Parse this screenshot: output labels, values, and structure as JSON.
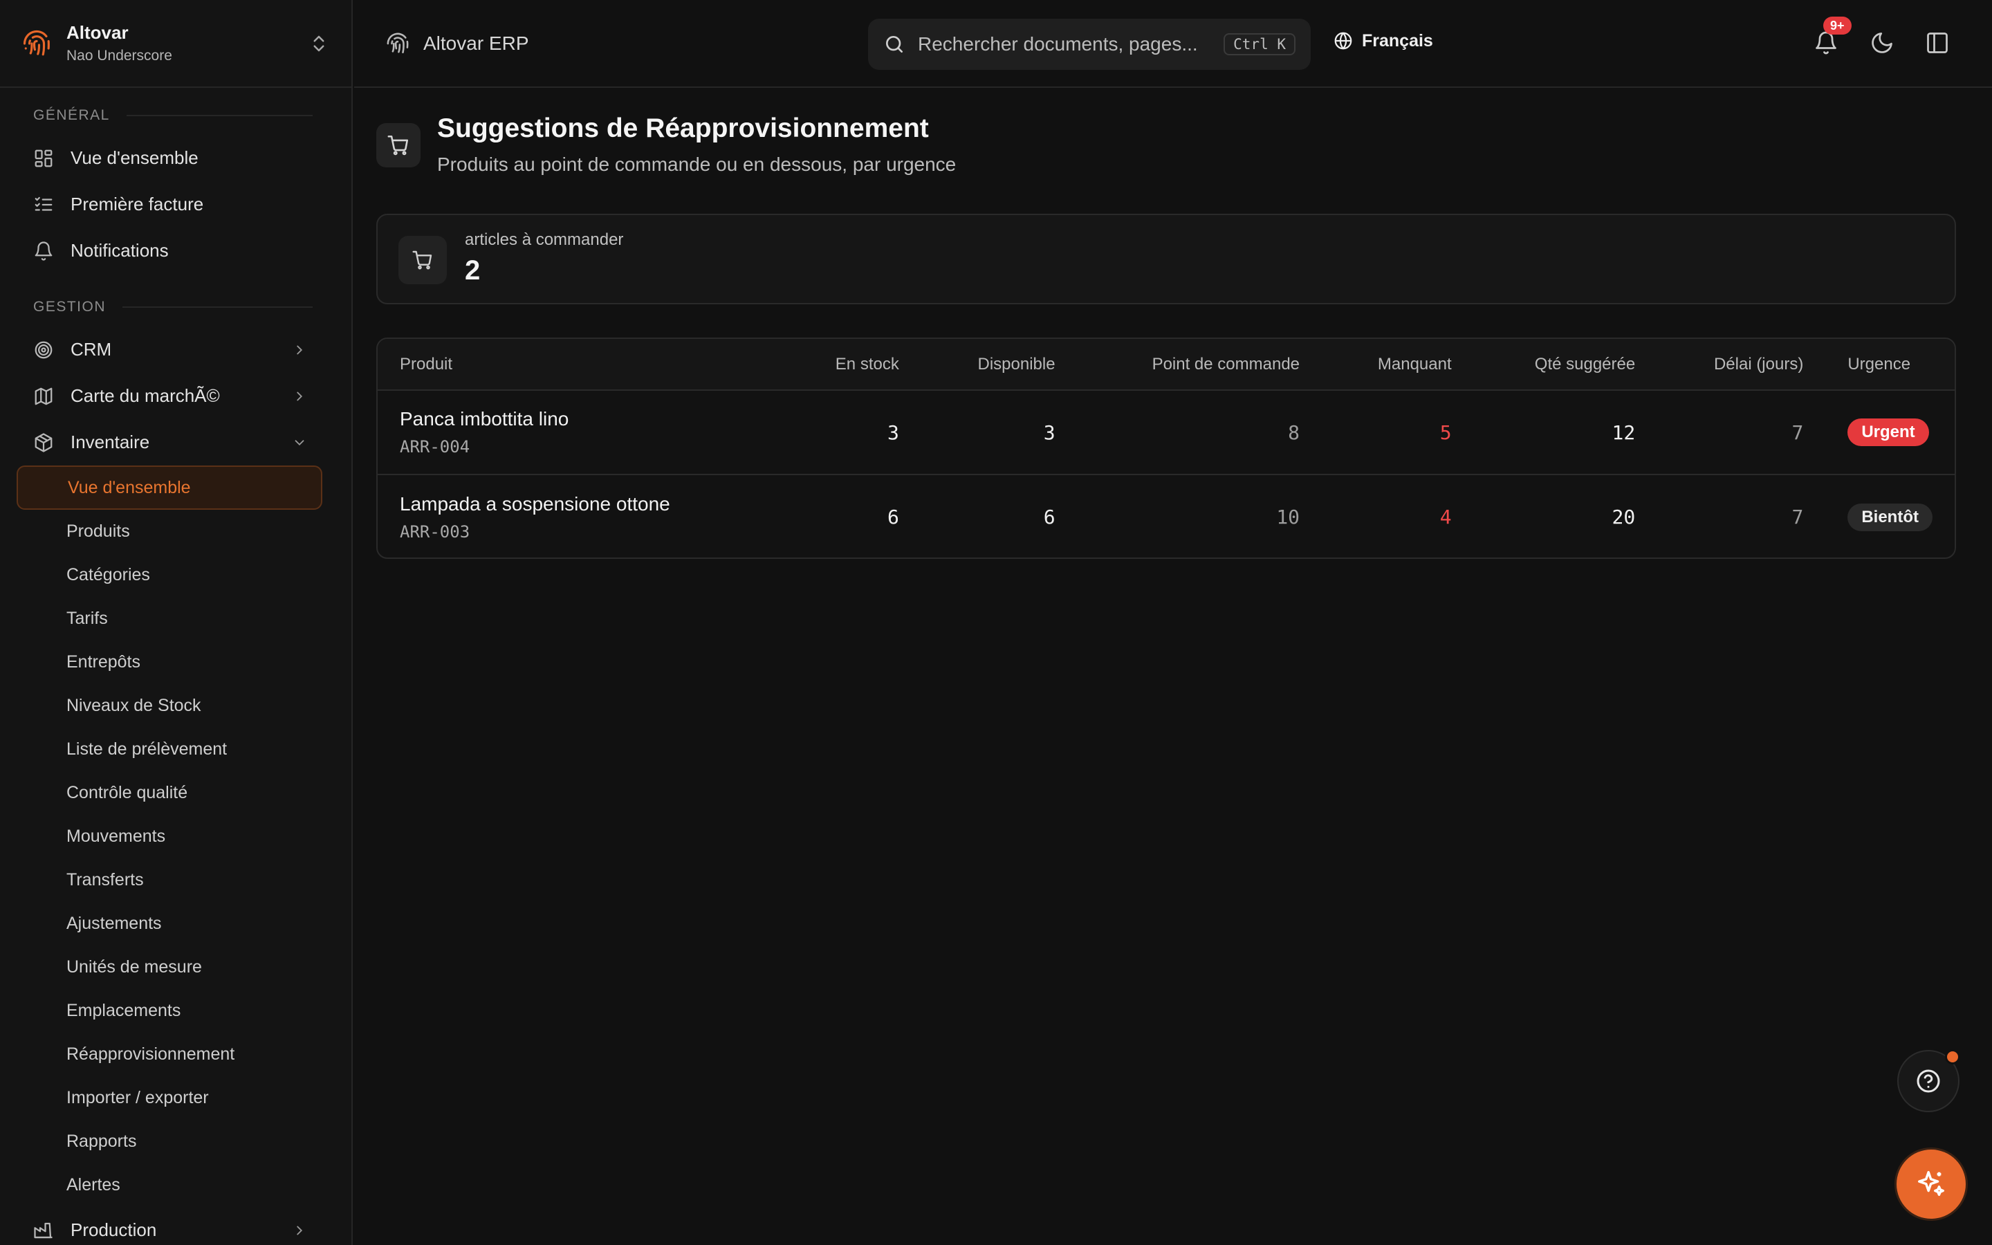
{
  "org": {
    "name": "Altovar",
    "subtitle": "Nao Underscore"
  },
  "sidebar": {
    "sections": [
      {
        "label": "GÉNÉRAL",
        "items": [
          {
            "label": "Vue d'ensemble",
            "icon": "dashboard-icon"
          },
          {
            "label": "Première facture",
            "icon": "checklist-icon"
          },
          {
            "label": "Notifications",
            "icon": "bell-icon"
          }
        ]
      },
      {
        "label": "GESTION",
        "items": [
          {
            "label": "CRM",
            "icon": "target-icon"
          },
          {
            "label": "Carte du marchÃ©",
            "icon": "map-icon"
          },
          {
            "label": "Inventaire",
            "icon": "box-icon"
          }
        ]
      }
    ],
    "inventory_sub": [
      "Vue d'ensemble",
      "Produits",
      "Catégories",
      "Tarifs",
      "Entrepôts",
      "Niveaux de Stock",
      "Liste de prélèvement",
      "Contrôle qualité",
      "Mouvements",
      "Transferts",
      "Ajustements",
      "Unités de mesure",
      "Emplacements",
      "Réapprovisionnement",
      "Importer / exporter",
      "Rapports",
      "Alertes"
    ],
    "production": "Production"
  },
  "header": {
    "brand": "Altovar ERP",
    "search_placeholder": "Rechercher documents, pages...",
    "shortcut": "Ctrl K",
    "language": "Français",
    "notification_badge": "9+"
  },
  "page": {
    "title": "Suggestions de Réapprovisionnement",
    "subtitle": "Produits au point de commande ou en dessous, par urgence"
  },
  "stat": {
    "label": "articles à commander",
    "value": "2"
  },
  "table": {
    "columns": [
      "Produit",
      "En stock",
      "Disponible",
      "Point de commande",
      "Manquant",
      "Qté suggérée",
      "Délai (jours)",
      "Urgence"
    ],
    "rows": [
      {
        "name": "Panca imbottita lino",
        "sku": "ARR-004",
        "in_stock": "3",
        "available": "3",
        "reorder_point": "8",
        "missing": "5",
        "suggested": "12",
        "lead_time": "7",
        "urgency": "Urgent"
      },
      {
        "name": "Lampada a sospensione ottone",
        "sku": "ARR-003",
        "in_stock": "6",
        "available": "6",
        "reorder_point": "10",
        "missing": "4",
        "suggested": "20",
        "lead_time": "7",
        "urgency": "Bientôt"
      }
    ]
  },
  "colors": {
    "accent": "#e8672a",
    "danger": "#e5393c",
    "background": "#111111"
  }
}
